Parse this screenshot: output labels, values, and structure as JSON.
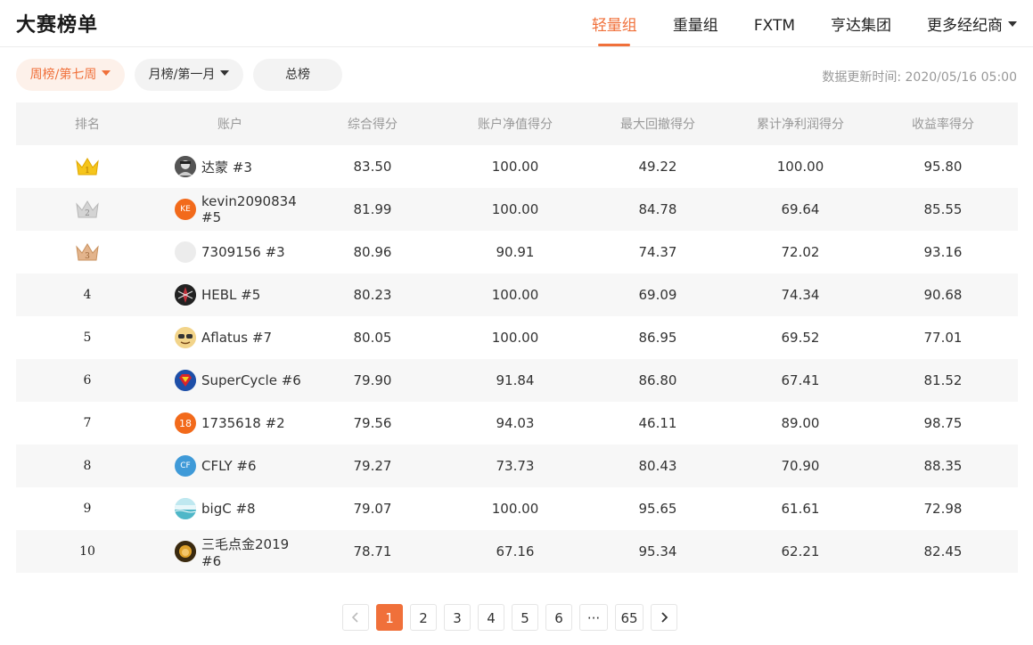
{
  "page_title": "大赛榜单",
  "tabs": [
    {
      "label": "轻量组",
      "active": true
    },
    {
      "label": "重量组",
      "active": false
    },
    {
      "label": "FXTM",
      "active": false
    },
    {
      "label": "亨达集团",
      "active": false
    },
    {
      "label": "更多经纪商",
      "active": false,
      "dropdown": true
    }
  ],
  "filters": {
    "weekly": "周榜/第七周",
    "monthly": "月榜/第一月",
    "total": "总榜"
  },
  "update_time": "数据更新时间: 2020/05/16 05:00",
  "table": {
    "headers": [
      "排名",
      "账户",
      "综合得分",
      "账户净值得分",
      "最大回撤得分",
      "累计净利润得分",
      "收益率得分"
    ],
    "rows": [
      {
        "rank": "1",
        "account": "达蒙 #3",
        "avatar": "avatar-photo-icon",
        "score": "83.50",
        "equity": "100.00",
        "drawdown": "49.22",
        "profit": "100.00",
        "return": "95.80"
      },
      {
        "rank": "2",
        "account": "kevin2090834 #5",
        "avatar_text": "KE",
        "score": "81.99",
        "equity": "100.00",
        "drawdown": "84.78",
        "profit": "69.64",
        "return": "85.55"
      },
      {
        "rank": "3",
        "account": "7309156 #3",
        "avatar": "avatar-blank-icon",
        "score": "80.96",
        "equity": "90.91",
        "drawdown": "74.37",
        "profit": "72.02",
        "return": "93.16"
      },
      {
        "rank": "4",
        "account": "HEBL #5",
        "avatar": "avatar-spider-icon",
        "score": "80.23",
        "equity": "100.00",
        "drawdown": "69.09",
        "profit": "74.34",
        "return": "90.68"
      },
      {
        "rank": "5",
        "account": "Aflatus #7",
        "avatar": "avatar-cartoon-icon",
        "score": "80.05",
        "equity": "100.00",
        "drawdown": "86.95",
        "profit": "69.52",
        "return": "77.01"
      },
      {
        "rank": "6",
        "account": "SuperCycle #6",
        "avatar": "avatar-superman-icon",
        "score": "79.90",
        "equity": "91.84",
        "drawdown": "86.80",
        "profit": "67.41",
        "return": "81.52"
      },
      {
        "rank": "7",
        "account": "1735618 #2",
        "avatar_text": "18",
        "score": "79.56",
        "equity": "94.03",
        "drawdown": "46.11",
        "profit": "89.00",
        "return": "98.75"
      },
      {
        "rank": "8",
        "account": "CFLY #6",
        "avatar_text": "CF",
        "score": "79.27",
        "equity": "73.73",
        "drawdown": "80.43",
        "profit": "70.90",
        "return": "88.35"
      },
      {
        "rank": "9",
        "account": "bigC #8",
        "avatar": "avatar-landscape-icon",
        "score": "79.07",
        "equity": "100.00",
        "drawdown": "95.65",
        "profit": "61.61",
        "return": "72.98"
      },
      {
        "rank": "10",
        "account": "三毛点金2019 #6",
        "avatar": "avatar-lion-icon",
        "score": "78.71",
        "equity": "67.16",
        "drawdown": "95.34",
        "profit": "62.21",
        "return": "82.45"
      }
    ]
  },
  "pagination": {
    "pages": [
      "1",
      "2",
      "3",
      "4",
      "5",
      "6"
    ],
    "ellipsis": "···",
    "last": "65",
    "current": "1"
  },
  "colors": {
    "accent": "#f0703a",
    "gold": "#f5c51c",
    "silver": "#c8c8c8",
    "bronze": "#dba77c"
  }
}
